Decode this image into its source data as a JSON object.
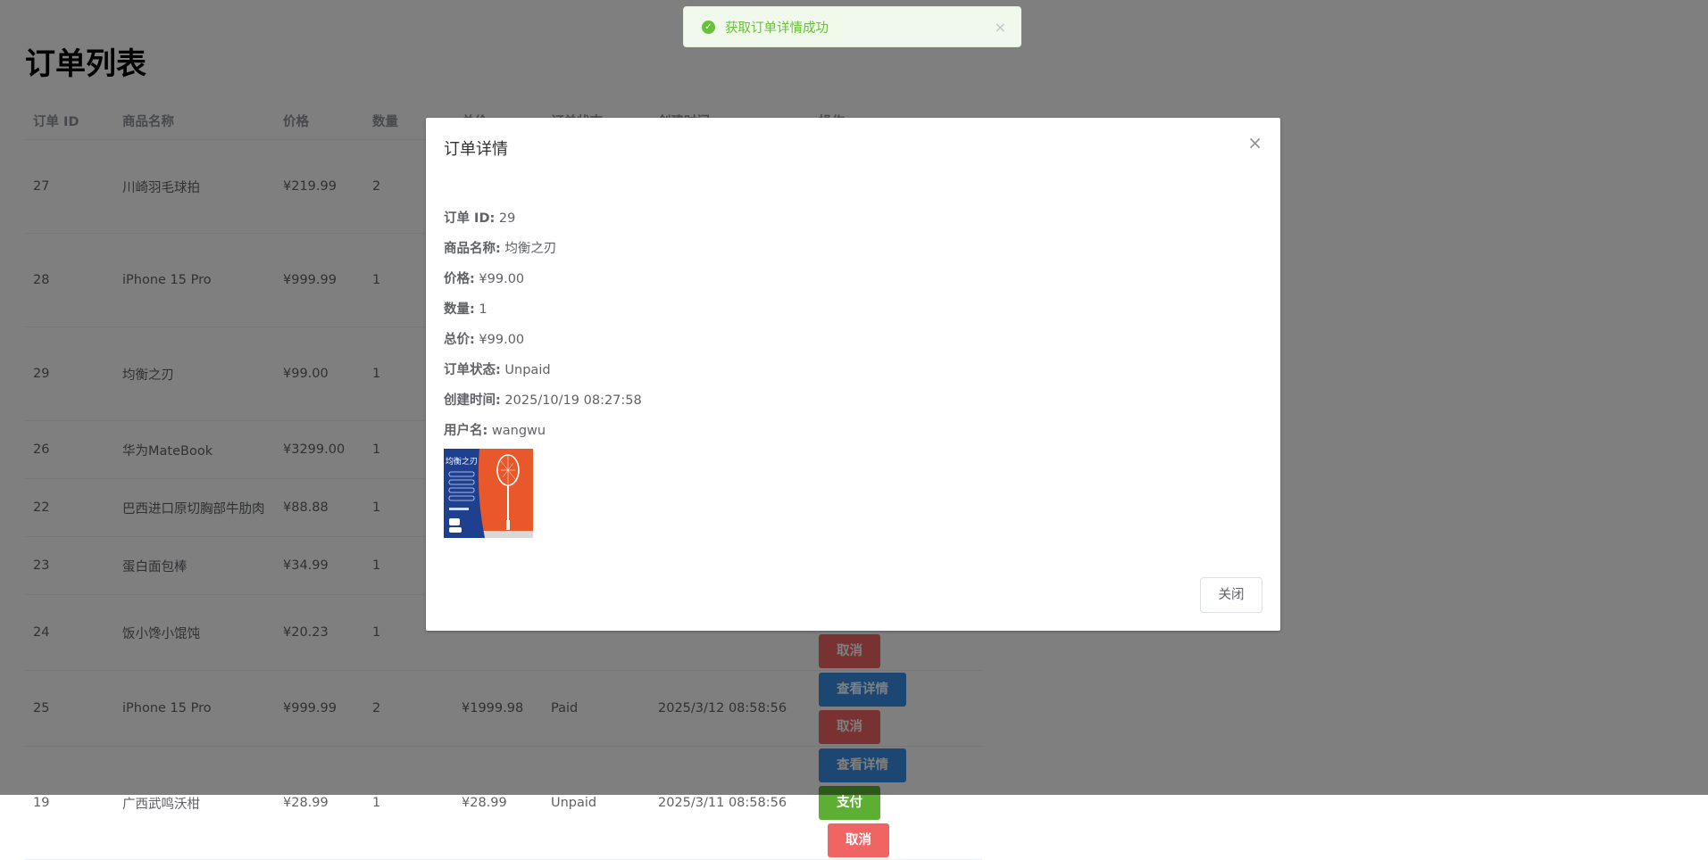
{
  "page": {
    "title": "订单列表"
  },
  "table": {
    "columns": [
      "订单 ID",
      "商品名称",
      "价格",
      "数量",
      "总价",
      "订单状态",
      "创建时间",
      "操作"
    ],
    "rows": [
      {
        "id": "27",
        "name": "川崎羽毛球拍",
        "price": "¥219.99",
        "qty": "2"
      },
      {
        "id": "28",
        "name": "iPhone 15 Pro",
        "price": "¥999.99",
        "qty": "1"
      },
      {
        "id": "29",
        "name": "均衡之刃",
        "price": "¥99.00",
        "qty": "1"
      },
      {
        "id": "26",
        "name": "华为MateBook",
        "price": "¥3299.00",
        "qty": "1"
      },
      {
        "id": "22",
        "name": "巴西进口原切胸部牛肋肉",
        "price": "¥88.88",
        "qty": "1"
      },
      {
        "id": "23",
        "name": "蛋白面包棒",
        "price": "¥34.99",
        "qty": "1"
      },
      {
        "id": "24",
        "name": "饭小馋小馄饨",
        "price": "¥20.23",
        "qty": "1"
      },
      {
        "id": "25",
        "name": "iPhone 15 Pro",
        "price": "¥999.99",
        "qty": "2",
        "total": "¥1999.98",
        "status": "Paid",
        "time": "2025/3/12 08:58:56"
      },
      {
        "id": "19",
        "name": "广西武鸣沃柑",
        "price": "¥28.99",
        "qty": "1",
        "total": "¥28.99",
        "status": "Unpaid",
        "time": "2025/3/11 08:58:56"
      }
    ],
    "btn_detail": "查看详情",
    "btn_cancel": "取消",
    "btn_pay": "支付"
  },
  "toast": {
    "message": "获取订单详情成功",
    "icon": "check-circle-icon",
    "close": "×"
  },
  "modal": {
    "title": "订单详情",
    "close_glyph": "×",
    "fields": [
      {
        "label": "订单 ID:",
        "value": "29"
      },
      {
        "label": "商品名称:",
        "value": "均衡之刃"
      },
      {
        "label": "价格:",
        "value": "¥99.00"
      },
      {
        "label": "数量:",
        "value": "1"
      },
      {
        "label": "总价:",
        "value": "¥99.00"
      },
      {
        "label": "订单状态:",
        "value": "Unpaid"
      },
      {
        "label": "创建时间:",
        "value": "2025/10/19 08:27:58"
      },
      {
        "label": "用户名:",
        "value": "wangwu"
      }
    ],
    "image": {
      "title": "均衡之刃"
    },
    "close_button": "关闭"
  },
  "colors": {
    "primary": "#3a8ee6",
    "danger": "#f06464",
    "success": "#5daf34",
    "toast_text": "#67c23a"
  }
}
